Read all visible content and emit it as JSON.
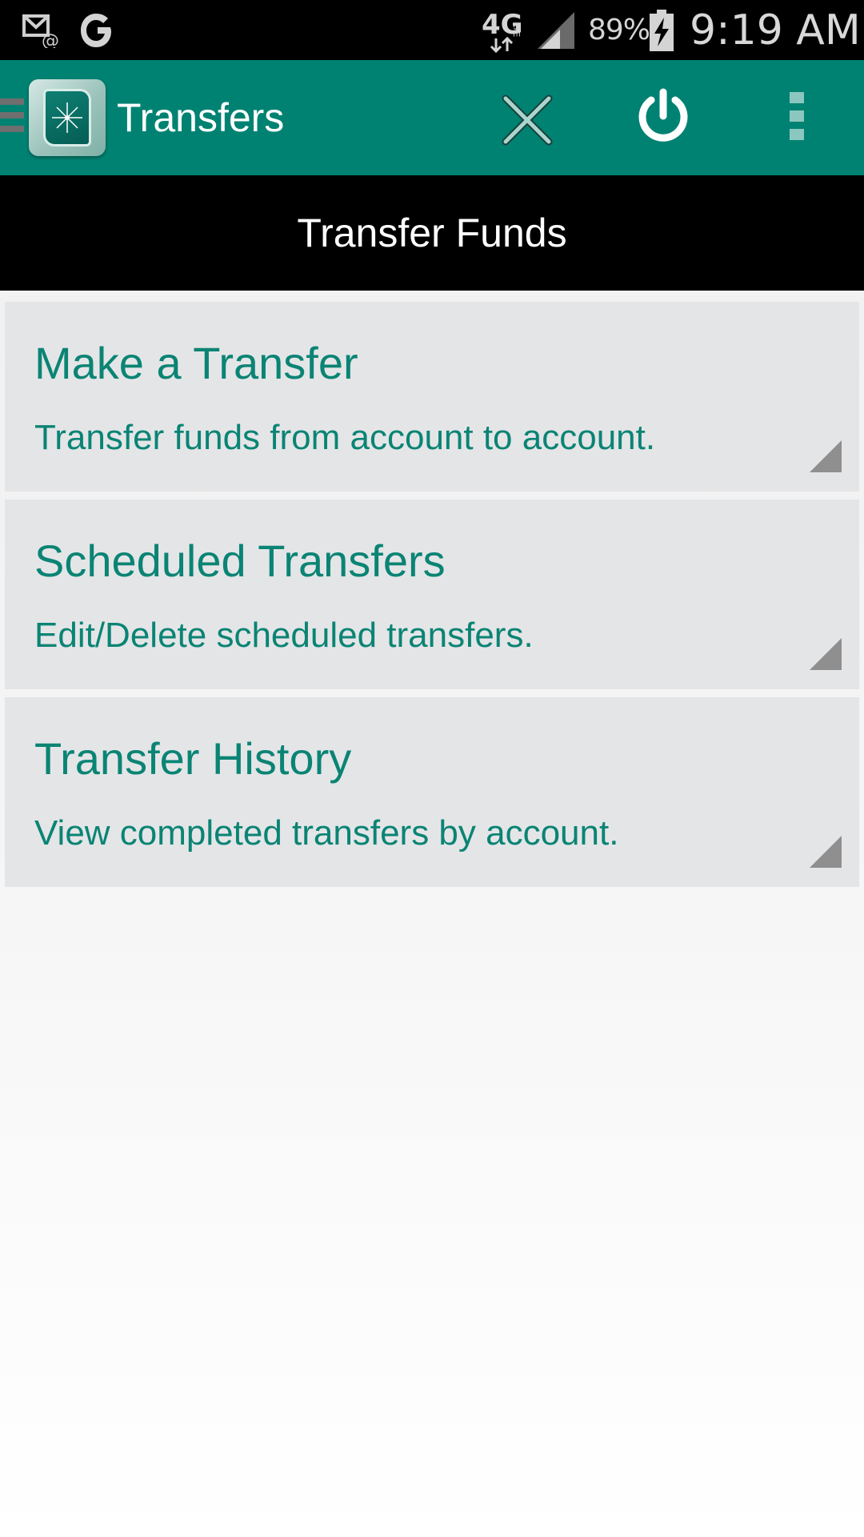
{
  "status_bar": {
    "battery_percent": "89%",
    "time": "9:19 AM",
    "network": "4G",
    "network_sub": "LTE",
    "icons": [
      "email-icon",
      "google-icon",
      "lte-icon",
      "signal-icon",
      "battery-charging-icon"
    ]
  },
  "app_bar": {
    "title": "Transfers",
    "icons": [
      "menu-icon",
      "app-logo-icon",
      "close-icon",
      "power-icon",
      "overflow-menu-icon"
    ],
    "background_color": "#008272"
  },
  "page_header": {
    "title": "Transfer Funds"
  },
  "options": [
    {
      "title": "Make a Transfer",
      "subtitle": "Transfer funds from account to account."
    },
    {
      "title": "Scheduled Transfers",
      "subtitle": "Edit/Delete scheduled transfers."
    },
    {
      "title": "Transfer History",
      "subtitle": "View completed transfers by account."
    }
  ],
  "colors": {
    "accent": "#0a8474",
    "card_background": "#e4e5e7"
  }
}
